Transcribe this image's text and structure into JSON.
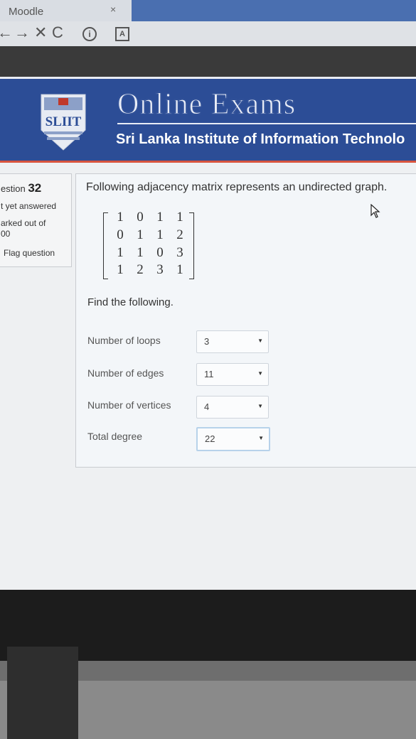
{
  "browser": {
    "tab_title": "Moodle",
    "tab_close": "×",
    "nav": {
      "back": "←",
      "forward": "→",
      "stop": "✕",
      "reload": "C"
    }
  },
  "banner": {
    "title": "Online Exams",
    "subtitle": "Sri Lanka Institute of Information Technolo",
    "logo_text": "SLIIT"
  },
  "question_info": {
    "label": "estion",
    "number": "32",
    "status": "t yet answered",
    "mark_line1": "arked out of",
    "mark_line2": "00",
    "flag": "Flag question"
  },
  "question": {
    "text": "Following adjacency matrix represents an undirected graph.",
    "matrix": [
      [
        "1",
        "0",
        "1",
        "1"
      ],
      [
        "0",
        "1",
        "1",
        "2"
      ],
      [
        "1",
        "1",
        "0",
        "3"
      ],
      [
        "1",
        "2",
        "3",
        "1"
      ]
    ],
    "find_label": "Find the following.",
    "fields": [
      {
        "label": "Number of loops",
        "value": "3"
      },
      {
        "label": "Number of edges",
        "value": "11"
      },
      {
        "label": "Number of vertices",
        "value": "4"
      },
      {
        "label": "Total degree",
        "value": "22"
      }
    ]
  }
}
